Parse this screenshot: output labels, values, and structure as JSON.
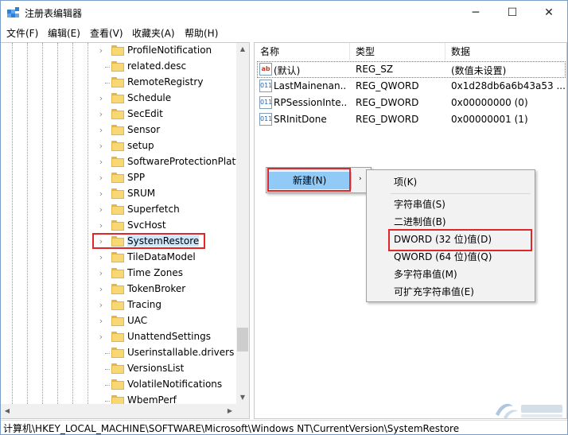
{
  "window": {
    "title": "注册表编辑器",
    "minimize_glyph": "─",
    "maximize_glyph": "☐",
    "close_glyph": "✕"
  },
  "menu": [
    "文件(F)",
    "编辑(E)",
    "查看(V)",
    "收藏夹(A)",
    "帮助(H)"
  ],
  "tree": {
    "items": [
      {
        "label": "ProfileNotification",
        "expandable": true
      },
      {
        "label": "related.desc",
        "expandable": false
      },
      {
        "label": "RemoteRegistry",
        "expandable": false
      },
      {
        "label": "Schedule",
        "expandable": true
      },
      {
        "label": "SecEdit",
        "expandable": true
      },
      {
        "label": "Sensor",
        "expandable": true
      },
      {
        "label": "setup",
        "expandable": true
      },
      {
        "label": "SoftwareProtectionPlatf",
        "expandable": true
      },
      {
        "label": "SPP",
        "expandable": true
      },
      {
        "label": "SRUM",
        "expandable": true
      },
      {
        "label": "Superfetch",
        "expandable": true
      },
      {
        "label": "SvcHost",
        "expandable": true
      },
      {
        "label": "SystemRestore",
        "expandable": true,
        "selected": true
      },
      {
        "label": "TileDataModel",
        "expandable": true
      },
      {
        "label": "Time Zones",
        "expandable": true
      },
      {
        "label": "TokenBroker",
        "expandable": true
      },
      {
        "label": "Tracing",
        "expandable": true
      },
      {
        "label": "UAC",
        "expandable": true
      },
      {
        "label": "UnattendSettings",
        "expandable": true
      },
      {
        "label": "Userinstallable.drivers",
        "expandable": false
      },
      {
        "label": "VersionsList",
        "expandable": false
      },
      {
        "label": "VolatileNotifications",
        "expandable": false
      },
      {
        "label": "WbemPerf",
        "expandable": false
      }
    ]
  },
  "list": {
    "headers": [
      "名称",
      "类型",
      "数据"
    ],
    "rows": [
      {
        "icon": "ab",
        "name": "(默认)",
        "type": "REG_SZ",
        "data": "(数值未设置)"
      },
      {
        "icon": "011",
        "name": "LastMainenan...",
        "type": "REG_QWORD",
        "data": "0x1d28db6a6b43a53 ..."
      },
      {
        "icon": "011",
        "name": "RPSessionInte...",
        "type": "REG_DWORD",
        "data": "0x00000000 (0)"
      },
      {
        "icon": "011",
        "name": "SRInitDone",
        "type": "REG_DWORD",
        "data": "0x00000001 (1)"
      }
    ]
  },
  "context_menu": {
    "new_label": "新建(N)",
    "submenu_arrow": "›"
  },
  "submenu": {
    "items": [
      "项(K)",
      "字符串值(S)",
      "二进制值(B)",
      "DWORD (32 位)值(D)",
      "QWORD (64 位)值(Q)",
      "多字符串值(M)",
      "可扩充字符串值(E)"
    ]
  },
  "status": {
    "path": "计算机\\HKEY_LOCAL_MACHINE\\SOFTWARE\\Microsoft\\Windows NT\\CurrentVersion\\SystemRestore"
  },
  "colors": {
    "highlight_red": "#e0262b",
    "menu_active": "#91c9f7",
    "folder": "#f8d775"
  }
}
